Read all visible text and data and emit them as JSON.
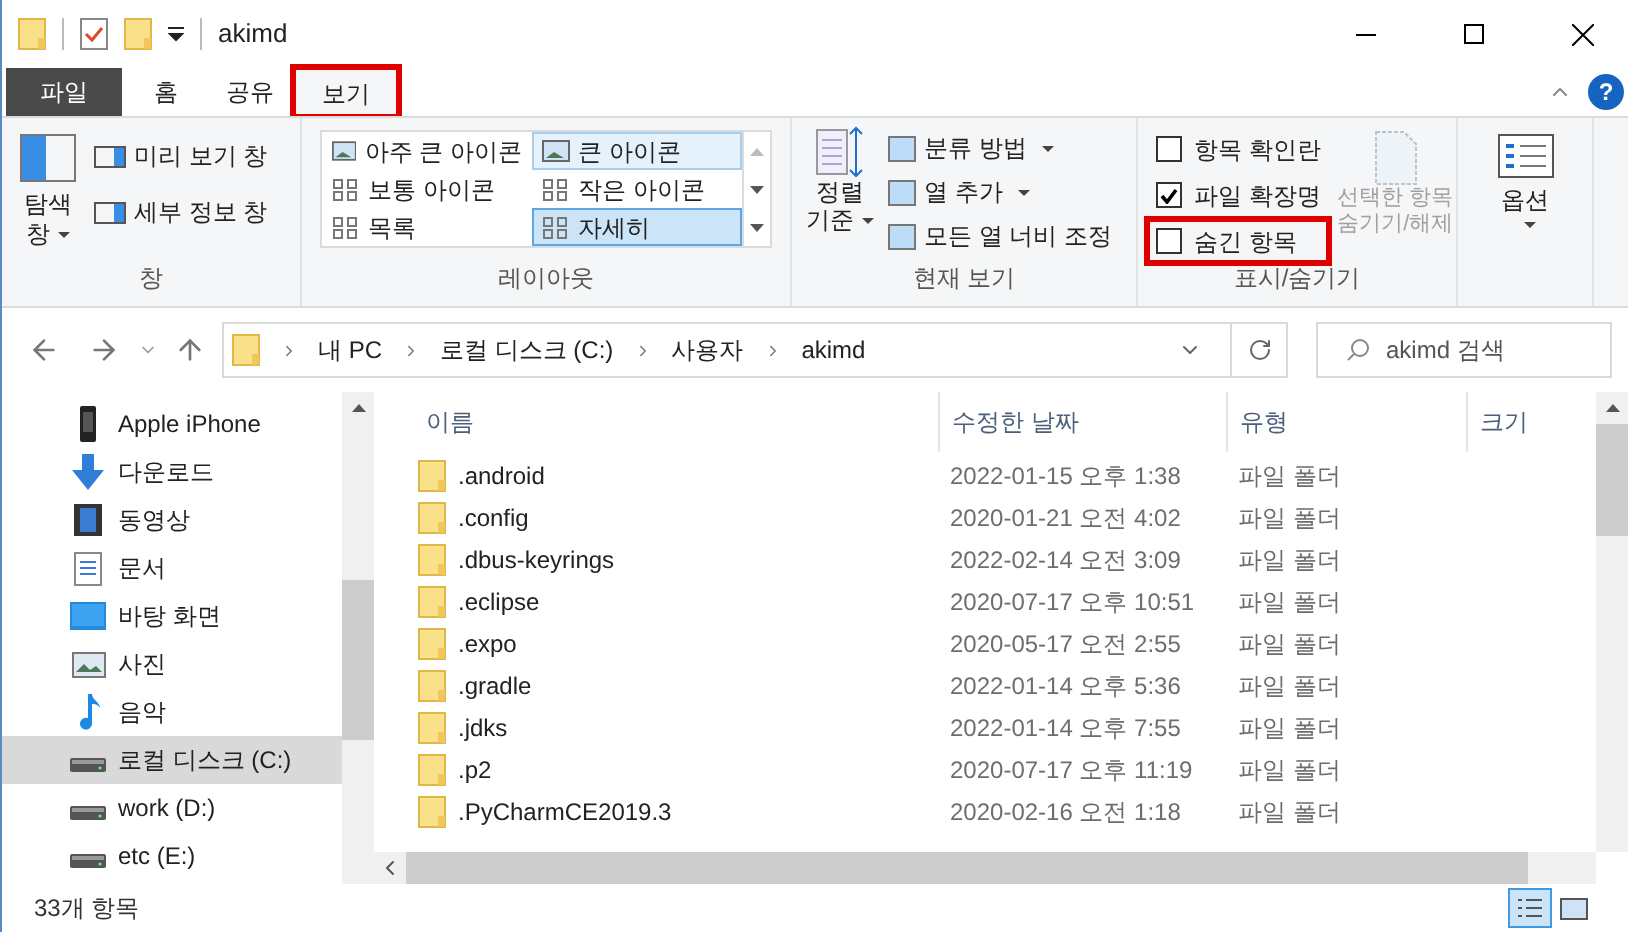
{
  "window": {
    "title": "akimd"
  },
  "ribbon_tabs": [
    {
      "label": "파일",
      "kind": "file",
      "selected": false,
      "highlighted": false
    },
    {
      "label": "홈",
      "kind": "tab",
      "selected": false,
      "highlighted": false
    },
    {
      "label": "공유",
      "kind": "tab",
      "selected": false,
      "highlighted": false
    },
    {
      "label": "보기",
      "kind": "tab",
      "selected": true,
      "highlighted": true
    }
  ],
  "ribbon": {
    "pane_group": {
      "label": "창",
      "nav_pane": "탐색 창",
      "preview_pane": "미리 보기 창",
      "details_pane": "세부 정보 창"
    },
    "layout_group": {
      "label": "레이아웃",
      "options": [
        {
          "label": "아주 큰 아이콘",
          "selected": false,
          "hovered": false
        },
        {
          "label": "큰 아이콘",
          "selected": false,
          "hovered": true
        },
        {
          "label": "보통 아이콘",
          "selected": false,
          "hovered": false
        },
        {
          "label": "작은 아이콘",
          "selected": false,
          "hovered": false
        },
        {
          "label": "목록",
          "selected": false,
          "hovered": false
        },
        {
          "label": "자세히",
          "selected": true,
          "hovered": false
        }
      ]
    },
    "view_group": {
      "label": "현재 보기",
      "sort_by": "정렬 기준",
      "items": [
        {
          "label": "분류 방법",
          "dropdown": true
        },
        {
          "label": "열 추가",
          "dropdown": true
        },
        {
          "label": "모든 열 너비 조정",
          "dropdown": false
        }
      ]
    },
    "show_hide_group": {
      "label": "표시/숨기기",
      "checks": [
        {
          "label": "항목 확인란",
          "checked": false,
          "highlighted": false
        },
        {
          "label": "파일 확장명",
          "checked": true,
          "highlighted": false
        },
        {
          "label": "숨긴 항목",
          "checked": false,
          "highlighted": true
        }
      ],
      "hide_selected": {
        "label": "선택한 항목 숨기기/해제",
        "disabled": true
      }
    },
    "options": {
      "label": "옵션"
    },
    "help": {
      "label": "?"
    }
  },
  "address_bar": {
    "crumbs": [
      "내 PC",
      "로컬 디스크 (C:)",
      "사용자",
      "akimd"
    ]
  },
  "search": {
    "placeholder": "akimd 검색"
  },
  "sidebar": {
    "items": [
      {
        "label": "Apple iPhone",
        "kind": "phone",
        "selected": false
      },
      {
        "label": "다운로드",
        "kind": "download",
        "selected": false
      },
      {
        "label": "동영상",
        "kind": "video",
        "selected": false
      },
      {
        "label": "문서",
        "kind": "document",
        "selected": false
      },
      {
        "label": "바탕 화면",
        "kind": "desktop",
        "selected": false
      },
      {
        "label": "사진",
        "kind": "picture",
        "selected": false
      },
      {
        "label": "음악",
        "kind": "music",
        "selected": false
      },
      {
        "label": "로컬 디스크 (C:)",
        "kind": "drive",
        "selected": true
      },
      {
        "label": "work (D:)",
        "kind": "drive",
        "selected": false
      },
      {
        "label": "etc (E:)",
        "kind": "drive",
        "selected": false
      }
    ]
  },
  "table": {
    "columns": [
      "이름",
      "수정한 날짜",
      "유형",
      "크기"
    ],
    "rows": [
      {
        "name": ".android",
        "modified": "2022-01-15 오후 1:38",
        "type": "파일 폴더"
      },
      {
        "name": ".config",
        "modified": "2020-01-21 오전 4:02",
        "type": "파일 폴더"
      },
      {
        "name": ".dbus-keyrings",
        "modified": "2022-02-14 오전 3:09",
        "type": "파일 폴더"
      },
      {
        "name": ".eclipse",
        "modified": "2020-07-17 오후 10:51",
        "type": "파일 폴더"
      },
      {
        "name": ".expo",
        "modified": "2020-05-17 오전 2:55",
        "type": "파일 폴더"
      },
      {
        "name": ".gradle",
        "modified": "2022-01-14 오후 5:36",
        "type": "파일 폴더"
      },
      {
        "name": ".jdks",
        "modified": "2022-01-14 오후 7:55",
        "type": "파일 폴더"
      },
      {
        "name": ".p2",
        "modified": "2020-07-17 오후 11:19",
        "type": "파일 폴더"
      },
      {
        "name": ".PyCharmCE2019.3",
        "modified": "2020-02-16 오전 1:18",
        "type": "파일 폴더"
      }
    ]
  },
  "status_bar": {
    "item_count": "33개 항목",
    "views": [
      {
        "kind": "details",
        "selected": true
      },
      {
        "kind": "large",
        "selected": false
      }
    ]
  }
}
